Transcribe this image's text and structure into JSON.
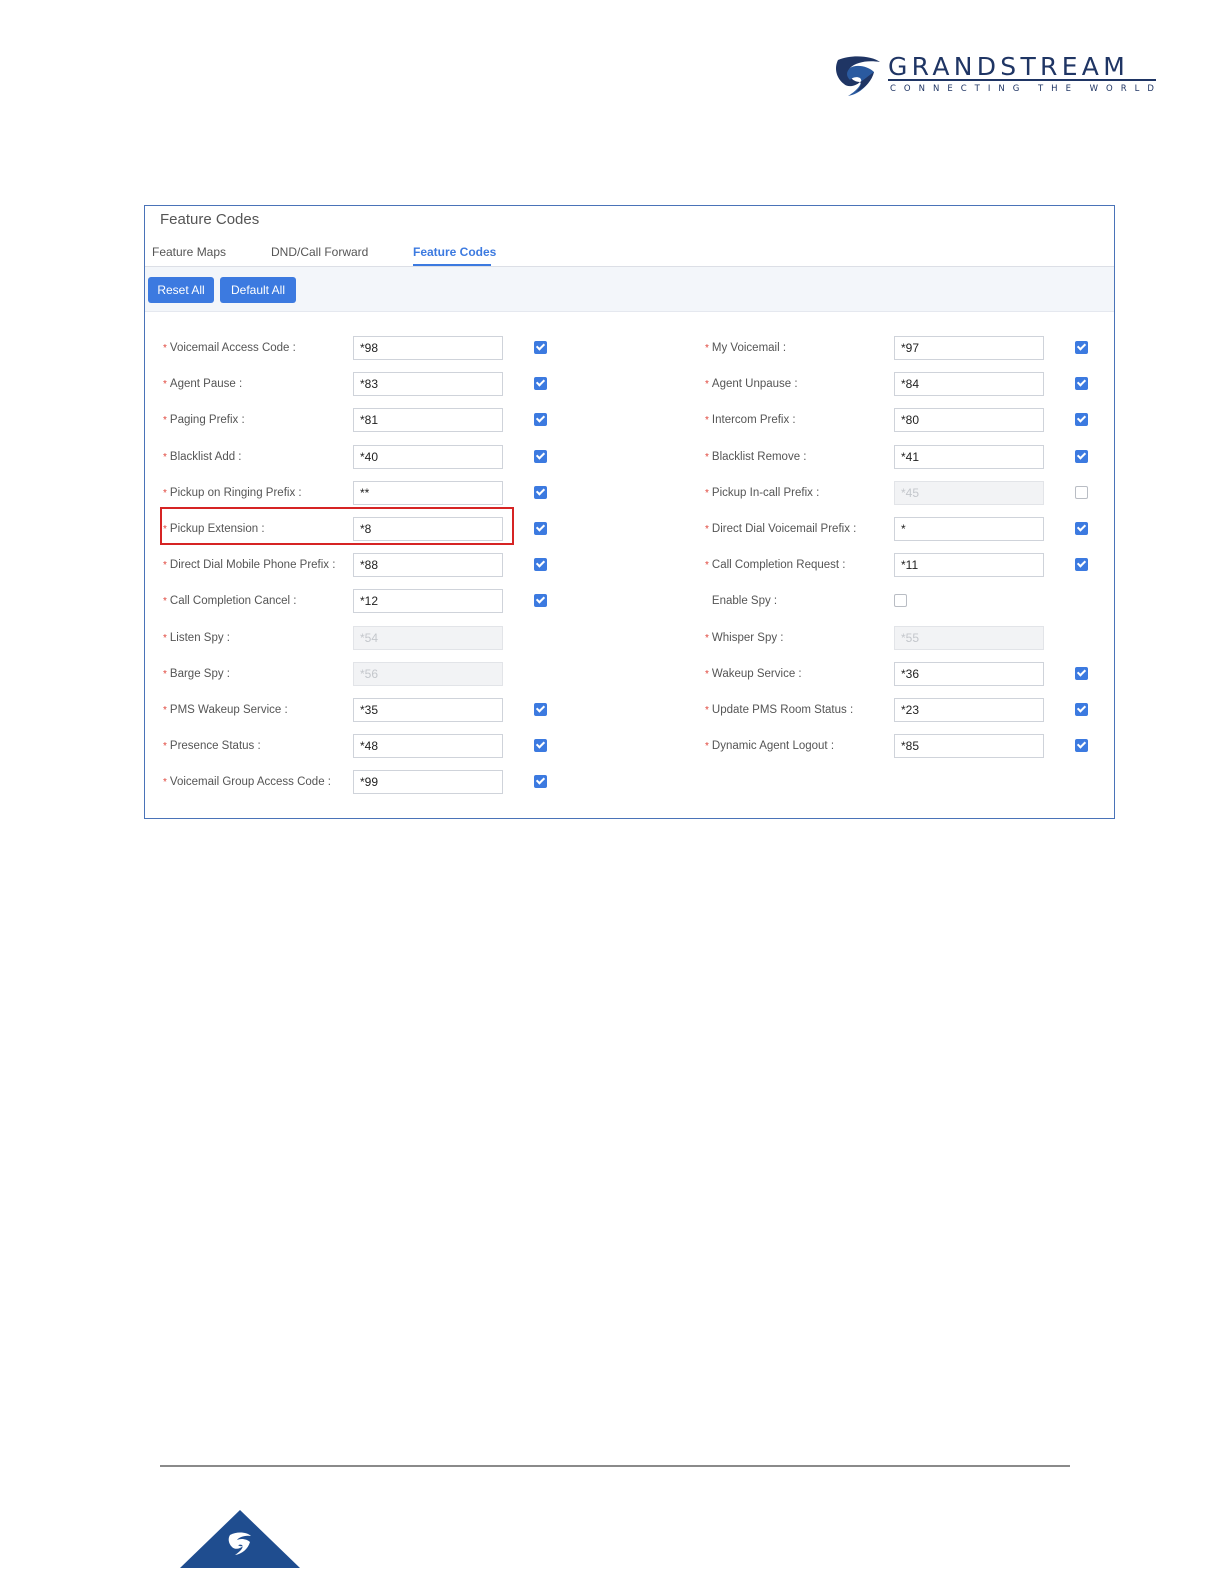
{
  "logo": {
    "word": "GRANDSTREAM",
    "tagline": "CONNECTING THE WORLD"
  },
  "panel": {
    "title": "Feature Codes",
    "tabs": [
      "Feature Maps",
      "DND/Call Forward",
      "Feature Codes"
    ],
    "active_tab": "Feature Codes",
    "buttons": {
      "reset": "Reset All",
      "default": "Default All"
    }
  },
  "left_fields": [
    {
      "label": "Voicemail Access Code",
      "value": "*98",
      "required": true,
      "enabled": true,
      "checked": true
    },
    {
      "label": "Agent Pause",
      "value": "*83",
      "required": true,
      "enabled": true,
      "checked": true
    },
    {
      "label": "Paging Prefix",
      "value": "*81",
      "required": true,
      "enabled": true,
      "checked": true
    },
    {
      "label": "Blacklist Add",
      "value": "*40",
      "required": true,
      "enabled": true,
      "checked": true
    },
    {
      "label": "Pickup on Ringing Prefix",
      "value": "**",
      "required": true,
      "enabled": true,
      "checked": true
    },
    {
      "label": "Pickup Extension",
      "value": "*8",
      "required": true,
      "enabled": true,
      "checked": true
    },
    {
      "label": "Direct Dial Mobile Phone Prefix",
      "value": "*88",
      "required": true,
      "enabled": true,
      "checked": true
    },
    {
      "label": "Call Completion Cancel",
      "value": "*12",
      "required": true,
      "enabled": true,
      "checked": true
    },
    {
      "label": "Listen Spy",
      "value": "*54",
      "required": true,
      "enabled": false,
      "checked": null
    },
    {
      "label": "Barge Spy",
      "value": "*56",
      "required": true,
      "enabled": false,
      "checked": null
    },
    {
      "label": "PMS Wakeup Service",
      "value": "*35",
      "required": true,
      "enabled": true,
      "checked": true
    },
    {
      "label": "Presence Status",
      "value": "*48",
      "required": true,
      "enabled": true,
      "checked": true
    },
    {
      "label": "Voicemail Group Access Code",
      "value": "*99",
      "required": true,
      "enabled": true,
      "checked": true
    }
  ],
  "right_fields": [
    {
      "label": "My Voicemail",
      "value": "*97",
      "required": true,
      "enabled": true,
      "checked": true
    },
    {
      "label": "Agent Unpause",
      "value": "*84",
      "required": true,
      "enabled": true,
      "checked": true
    },
    {
      "label": "Intercom Prefix",
      "value": "*80",
      "required": true,
      "enabled": true,
      "checked": true
    },
    {
      "label": "Blacklist Remove",
      "value": "*41",
      "required": true,
      "enabled": true,
      "checked": true
    },
    {
      "label": "Pickup In-call Prefix",
      "value": "*45",
      "required": true,
      "enabled": false,
      "checked": false
    },
    {
      "label": "Direct Dial Voicemail Prefix",
      "value": "*",
      "required": true,
      "enabled": true,
      "checked": true
    },
    {
      "label": "Call Completion Request",
      "value": "*11",
      "required": true,
      "enabled": true,
      "checked": true
    },
    {
      "label": "Enable Spy",
      "value": null,
      "required": false,
      "enabled": true,
      "checked": false
    },
    {
      "label": "Whisper Spy",
      "value": "*55",
      "required": true,
      "enabled": false,
      "checked": null
    },
    {
      "label": "Wakeup Service",
      "value": "*36",
      "required": true,
      "enabled": true,
      "checked": true
    },
    {
      "label": "Update PMS Room Status",
      "value": "*23",
      "required": true,
      "enabled": true,
      "checked": true
    },
    {
      "label": "Dynamic Agent Logout",
      "value": "*85",
      "required": true,
      "enabled": true,
      "checked": true
    }
  ],
  "highlighted_field": "Pickup Extension",
  "colors": {
    "accent": "#3c7ae0",
    "highlight_border": "#d62424",
    "brand": "#1f3564"
  }
}
